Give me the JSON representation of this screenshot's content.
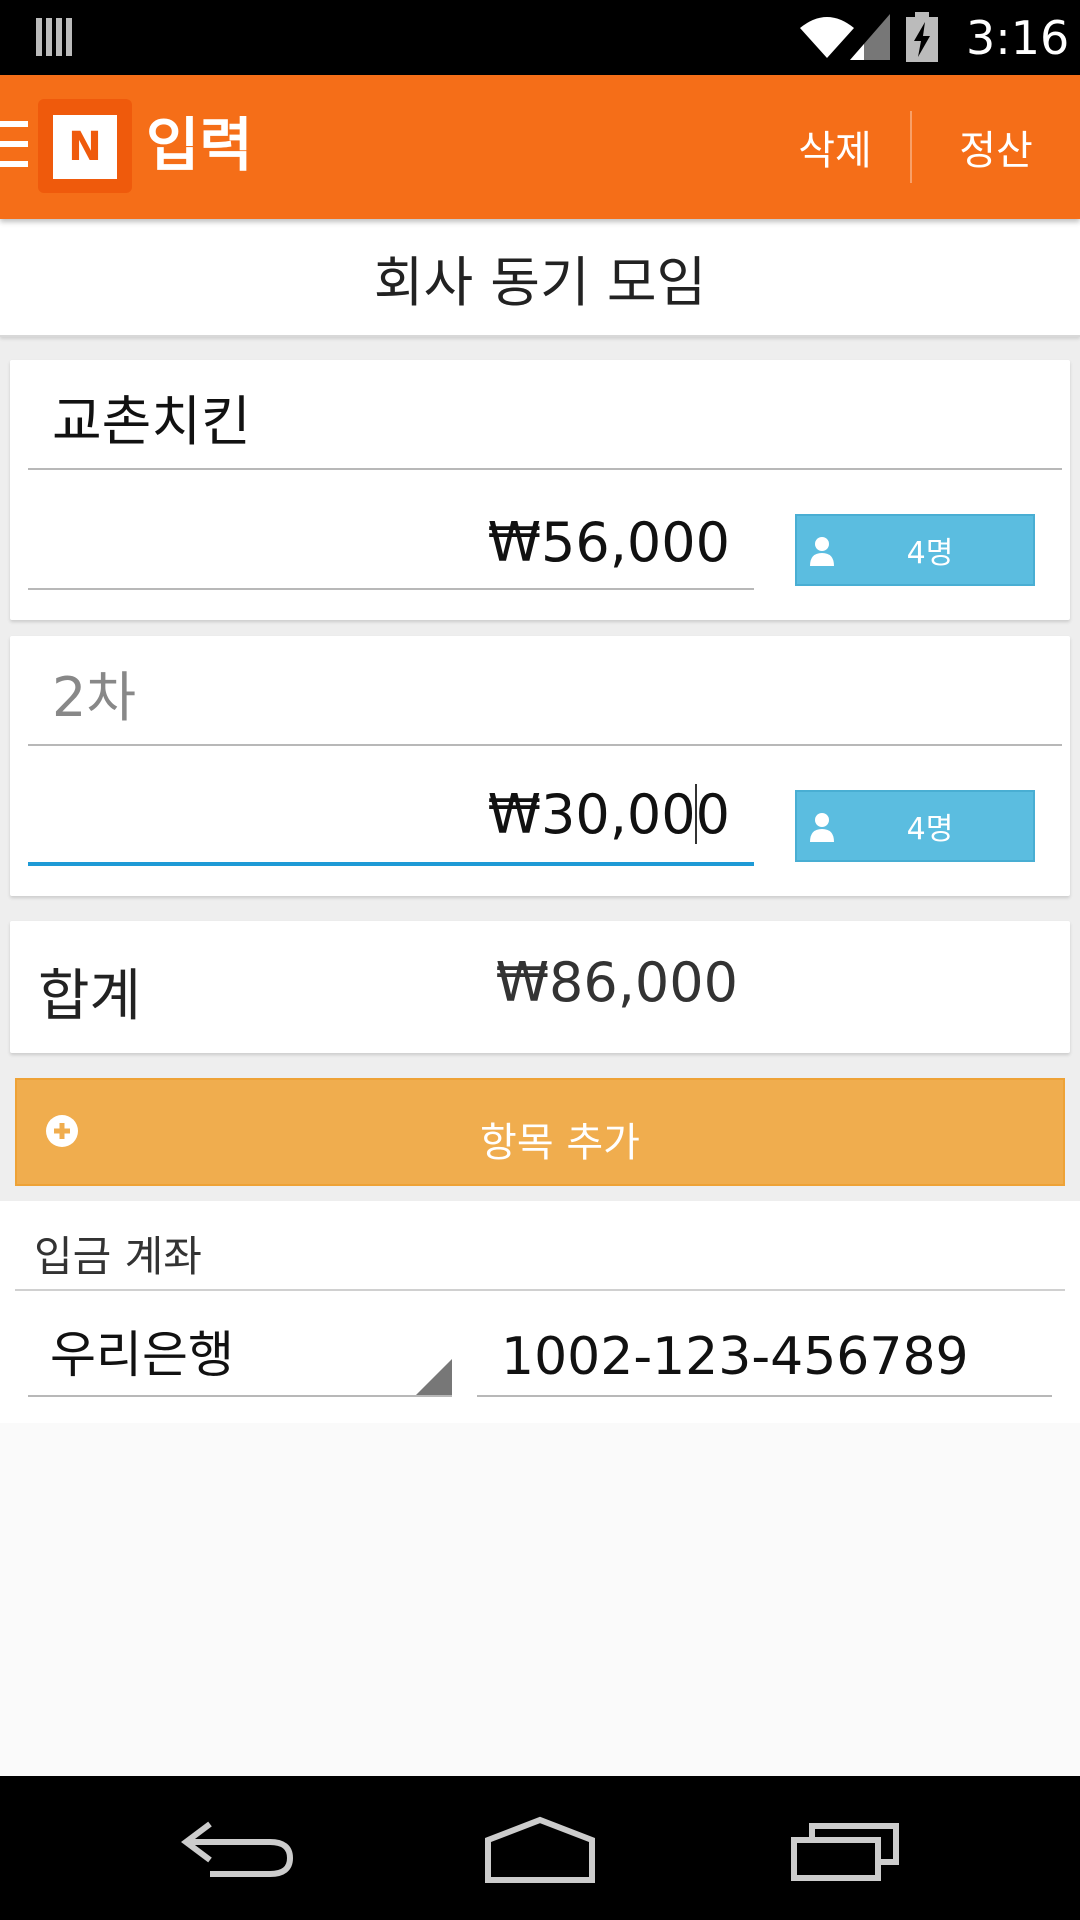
{
  "status_bar": {
    "time": "3:16",
    "icons": [
      "notification-bars-icon",
      "wifi-icon",
      "signal-icon",
      "battery-charging-icon"
    ]
  },
  "app_bar": {
    "title": "입력",
    "logo_letter": "N",
    "actions": {
      "delete": "삭제",
      "settle": "정산"
    }
  },
  "group": {
    "title": "회사 동기 모임"
  },
  "items": [
    {
      "name": "교촌치킨",
      "amount": "₩56,000",
      "people": "4명"
    },
    {
      "name_placeholder": "2차",
      "amount_before_cursor": "₩30,00",
      "amount_after_cursor": "0",
      "people": "4명"
    }
  ],
  "total": {
    "label": "합계",
    "value": "₩86,000"
  },
  "add_item": {
    "label": "항목 추가"
  },
  "account": {
    "title": "입금 계좌",
    "bank": "우리은행",
    "number": "1002-123-456789"
  },
  "colors": {
    "app_bar": "#f56e18",
    "people_button": "#5bbde0",
    "add_button": "#f0ad4e",
    "active_underline": "#1e9ad6"
  },
  "nav_bar": {
    "icons": [
      "back-icon",
      "home-icon",
      "recents-icon"
    ]
  }
}
